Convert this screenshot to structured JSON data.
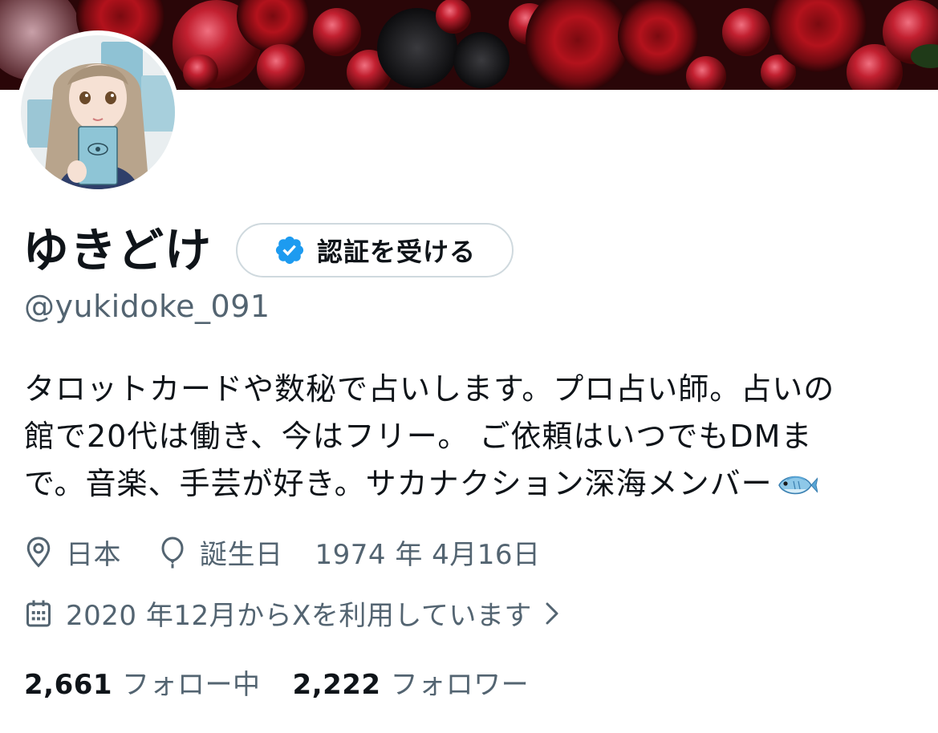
{
  "profile": {
    "display_name": "ゆきどけ",
    "handle": "@yukidoke_091",
    "verify_button_label": "認証を受ける",
    "bio_lines": [
      "タロットカードや数秘で占いします。プロ占い師。占いの",
      "館で20代は働き、今はフリー。 ご依頼はいつでもDMま",
      "で。音楽、手芸が好き。サカナクション深海メンバー"
    ],
    "bio_emoji": "fish-emoji",
    "location": "日本",
    "birthday_label": "誕生日",
    "birthday_value": "1974 年 4月16日",
    "joined": "2020 年12月からXを利用しています",
    "following_count": "2,661",
    "following_label": "フォロー中",
    "followers_count": "2,222",
    "followers_label": "フォロワー"
  },
  "icons": {
    "verify": "verified-badge-icon",
    "location": "location-pin-icon",
    "birthday": "balloon-icon",
    "joined": "calendar-icon",
    "chevron": "chevron-right-icon"
  },
  "colors": {
    "text_primary": "#0f1419",
    "text_secondary": "#536471",
    "verified_blue": "#1d9bf0",
    "button_border": "#cfd9de",
    "banner_dark": "#2a0608"
  }
}
